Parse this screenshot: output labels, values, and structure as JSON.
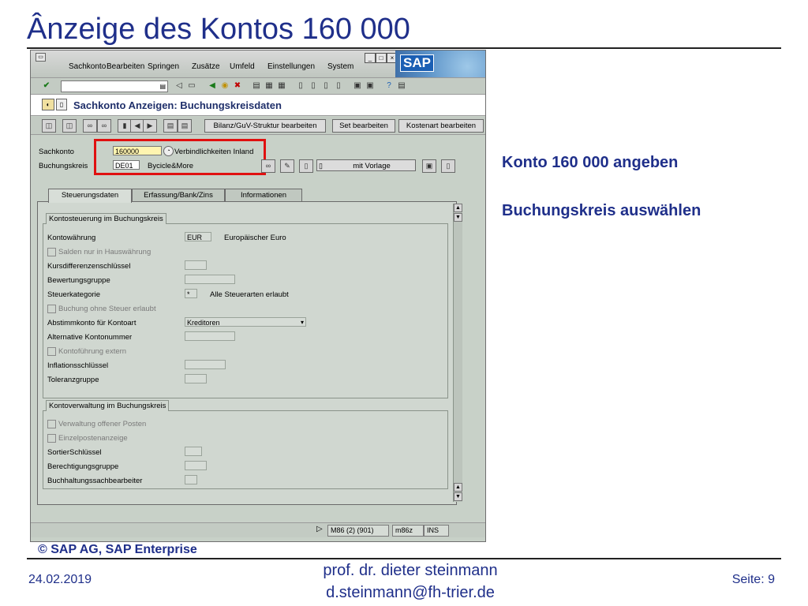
{
  "slide": {
    "title": "Ânzeige des Kontos 160 000",
    "copyright": "© SAP AG, SAP Enterprise",
    "annotations": [
      "Konto 160 000 angeben",
      "Buchungskreis auswählen"
    ]
  },
  "footer": {
    "date": "24.02.2019",
    "author_line1": "prof. dr. dieter steinmann",
    "author_line2": "d.steinmann@fh-trier.de",
    "page": "Seite: 9"
  },
  "sap": {
    "menu": [
      "Sachkonto",
      "Bearbeiten",
      "Springen",
      "Zusätze",
      "Umfeld",
      "Einstellungen",
      "System"
    ],
    "logo": "SAP",
    "screen_title": "Sachkonto Anzeigen: Buchungskreisdaten",
    "toolbar_buttons": [
      "Bilanz/GuV-Struktur bearbeiten",
      "Set bearbeiten",
      "Kostenart bearbeiten"
    ],
    "header": {
      "sachkonto_label": "Sachkonto",
      "sachkonto_value": "160000",
      "sachkonto_text": "Verbindlichkeiten Inland",
      "bukrs_label": "Buchungskreis",
      "bukrs_value": "DE01",
      "bukrs_text": "Bycicle&More",
      "vorlage_button": "mit Vorlage"
    },
    "tabs": [
      {
        "label": "Steuerungsdaten",
        "active": true
      },
      {
        "label": "Erfassung/Bank/Zins",
        "active": false
      },
      {
        "label": "Informationen",
        "active": false
      }
    ],
    "group1": {
      "title": "Kontosteuerung im Buchungskreis",
      "kontowaehrung_label": "Kontowährung",
      "kontowaehrung_value": "EUR",
      "kontowaehrung_text": "Europäischer Euro",
      "salden_label": "Salden nur in Hauswährung",
      "kursdiff_label": "Kursdifferenzenschlüssel",
      "bewertung_label": "Bewertungsgruppe",
      "steuerkat_label": "Steuerkategorie",
      "steuerkat_value": "*",
      "steuerkat_text": "Alle Steuerarten erlaubt",
      "buchung_ohne_steuer_label": "Buchung ohne Steuer erlaubt",
      "abstimm_label": "Abstimmkonto für Kontoart",
      "abstimm_value": "Kreditoren",
      "alt_konto_label": "Alternative Kontonummer",
      "kontofuehrung_label": "Kontoführung extern",
      "inflation_label": "Inflationsschlüssel",
      "toleranz_label": "Toleranzgruppe"
    },
    "group2": {
      "title": "Kontoverwaltung im Buchungskreis",
      "verwaltung_op_label": "Verwaltung offener Posten",
      "einzelposten_label": "Einzelpostenanzeige",
      "sortier_label": "SortierSchlüssel",
      "berecht_label": "Berechtigungsgruppe",
      "sachbearbeiter_label": "Buchhaltungssachbearbeiter"
    },
    "status": {
      "session": "M86 (2) (901)",
      "server": "m86z",
      "mode": "INS"
    }
  }
}
